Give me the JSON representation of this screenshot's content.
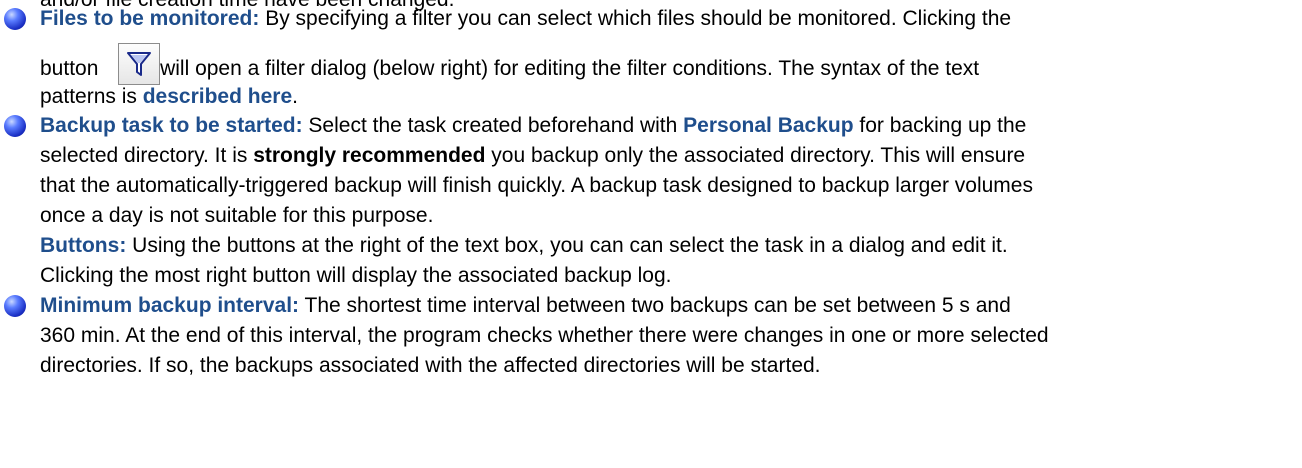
{
  "top_partial": "and/or file creation time have been changed.",
  "items": [
    {
      "term": "Files to be monitored:",
      "lines": {
        "l1": "By specifying a filter you can select which files should be monitored. Clicking the",
        "l2a": "button",
        "l2b": "will open a filter dialog (below right) for editing the filter conditions. The syntax of the text",
        "l3a": "patterns is",
        "l3link": "described here",
        "l3b": "."
      }
    },
    {
      "term": "Backup task to be started:",
      "lines": {
        "l1a": "Select the task created beforehand with",
        "l1link": "Personal Backup",
        "l1b": "for backing up the",
        "l2a": "selected directory. It is",
        "l2bold": "strongly recommended",
        "l2b": "you backup only the associated directory. This will ensure",
        "l3": "that the automatically-triggered backup will finish quickly. A backup task designed to backup larger volumes",
        "l4": "once a day is not suitable for this purpose."
      },
      "sub": {
        "term": "Buttons:",
        "l1": "Using the buttons at the right of the text box, you can can select the task in a dialog and edit it.",
        "l2": "Clicking the most right button will display the associated backup log."
      }
    },
    {
      "term": "Minimum backup interval:",
      "lines": {
        "l1": "The shortest time interval between two backups can be set between 5 s and",
        "l2": "360 min. At the end of this interval, the program checks whether there were changes in one or more selected",
        "l3": "directories. If so, the backups associated with the affected directories will be started."
      }
    }
  ],
  "icons": {
    "bullet": "blue-sphere-bullet-icon",
    "filter_button": "filter-funnel-icon"
  }
}
